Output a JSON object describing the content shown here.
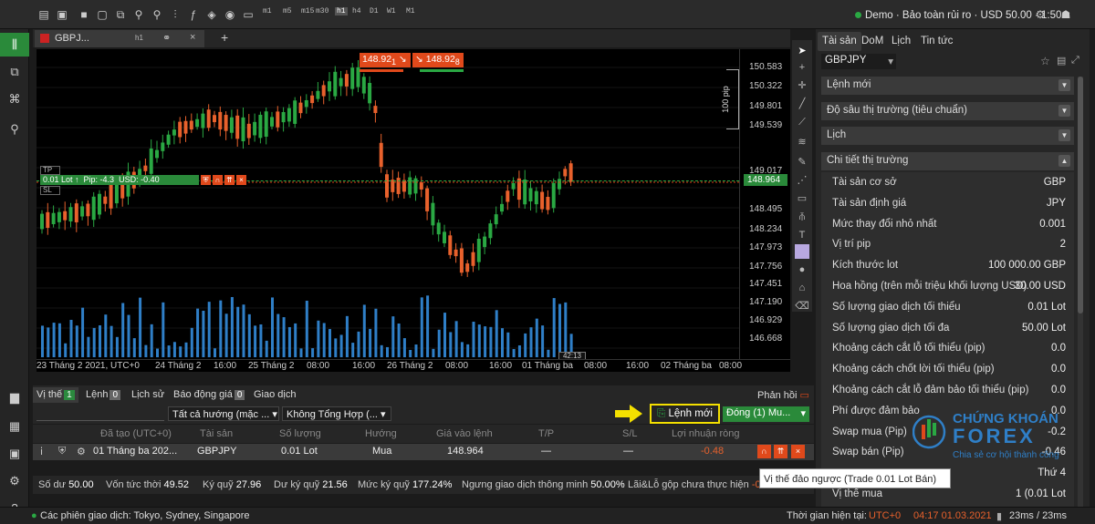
{
  "topbar": {
    "timeframes": [
      "m1",
      "m5",
      "m15",
      "m30",
      "h1",
      "h4",
      "D1",
      "W1",
      "M1"
    ],
    "active_timeframe": "h1",
    "account_status": "Demo · Bảo toàn rủi ro · USD 50.00 · 1:50"
  },
  "chart": {
    "tab_label": "GBPJ...",
    "tab_timeframe": "h1",
    "sell_price": "148.92",
    "sell_price_sub": "1",
    "buy_price": "148.92",
    "buy_price_sub": "8",
    "position_line": {
      "lot": "0.01 Lot",
      "pip": "Pip: -4.3",
      "usd": "USD: -0.40",
      "tp_label": "TP",
      "sl_label": "SL"
    },
    "pip_scale_label": "100 pip",
    "current_price": "148.964",
    "price_labels": [
      "150.583",
      "150.322",
      "149.801",
      "149.539",
      "149.017",
      "148.495",
      "148.234",
      "147.973",
      "147.756",
      "147.451",
      "147.190",
      "146.929",
      "146.668"
    ],
    "time_labels": [
      "23 Tháng 2 2021, UTC+0",
      "24 Tháng 2",
      "16:00",
      "25 Tháng 2",
      "08:00",
      "16:00",
      "26 Tháng 2",
      "08:00",
      "16:00",
      "01 Tháng ba",
      "08:00",
      "16:00",
      "02 Tháng ba",
      "08:00"
    ],
    "countdown": "42:13"
  },
  "right_panel": {
    "tabs": [
      "Tài sản",
      "DoM",
      "Lịch",
      "Tin tức"
    ],
    "asset": "GBPJPY",
    "sections": [
      "Lệnh mới",
      "Độ sâu thị trường (tiêu chuẩn)",
      "Lịch",
      "Chi tiết thị trường"
    ],
    "details": [
      {
        "label": "Tài sản cơ sở",
        "value": "GBP"
      },
      {
        "label": "Tài sản định giá",
        "value": "JPY"
      },
      {
        "label": "Mức thay đổi nhỏ nhất",
        "value": "0.001"
      },
      {
        "label": "Vị trí pip",
        "value": "2"
      },
      {
        "label": "Kích thước lot",
        "value": "100 000.00 GBP"
      },
      {
        "label": "Hoa hồng (trên mỗi triệu khối lượng USD)",
        "value": "30.00 USD"
      },
      {
        "label": "Số lượng giao dịch tối thiểu",
        "value": "0.01 Lot"
      },
      {
        "label": "Số lượng giao dịch tối đa",
        "value": "50.00 Lot"
      },
      {
        "label": "Khoảng cách cắt lỗ tối thiểu (pip)",
        "value": "0.0"
      },
      {
        "label": "Khoảng cách chốt lời tối thiểu (pip)",
        "value": "0.0"
      },
      {
        "label": "Khoảng cách cắt lỗ đảm bảo tối thiểu (pip)",
        "value": "0.0"
      },
      {
        "label": "Phí được đảm bảo",
        "value": "0.0"
      },
      {
        "label": "Swap mua (Pip)",
        "value": "-0.2"
      },
      {
        "label": "Swap bán (Pip)",
        "value": "-0.46"
      },
      {
        "label": "",
        "value": "Thứ 4"
      },
      {
        "label": "Vị thế mua",
        "value": "1 (0.01 Lot"
      }
    ]
  },
  "bottom": {
    "tabs": [
      {
        "label": "Vị thế",
        "count": "1"
      },
      {
        "label": "Lệnh",
        "count": "0"
      },
      {
        "label": "Lịch sử",
        "count": ""
      },
      {
        "label": "Báo động giá",
        "count": "0"
      },
      {
        "label": "Giao dịch",
        "count": ""
      }
    ],
    "feedback": "Phản hồi",
    "filter_direction": "Tất cả hướng (mặc ...",
    "filter_total": "Không Tổng Hợp (...",
    "new_order": "Lệnh mới",
    "close_btn": "Đóng (1) Mu...",
    "columns": [
      "Đã tạo (UTC+0)",
      "Tài sản",
      "Số lượng",
      "Hướng",
      "Giá vào lệnh",
      "T/P",
      "S/L",
      "Lợi nhuận ròng"
    ],
    "position": {
      "created": "01 Tháng ba 202...",
      "asset": "GBPJPY",
      "qty": "0.01 Lot",
      "direction": "Mua",
      "entry": "148.964",
      "tp": "—",
      "sl": "—",
      "pnl": "-0.48"
    },
    "status": [
      {
        "label": "Số dư",
        "value": "50.00"
      },
      {
        "label": "Vốn tức thời",
        "value": "49.52"
      },
      {
        "label": "Ký quỹ",
        "value": "27.96"
      },
      {
        "label": "Dư ký quỹ",
        "value": "21.56"
      },
      {
        "label": "Mức ký quỹ",
        "value": "177.24%"
      },
      {
        "label": "Ngưng giao dịch thông minh",
        "value": "50.00%"
      },
      {
        "label": "Lãi&Lỗ gộp chưa thực hiện",
        "value": "-0."
      }
    ],
    "tooltip": "Vị thế đảo ngược (Trade 0.01 Lot Bán)"
  },
  "footer": {
    "sessions": "Các phiên giao dịch: Tokyo, Sydney, Singapore",
    "server_time_label": "Thời gian hiện tại:",
    "timezone": "UTC+0",
    "time": "04:17 01.03.2021",
    "latency": "23ms / 23ms"
  },
  "watermark": {
    "brand": "CHỨNG KHOÁN FOREX",
    "tagline": "Chia sẻ cơ hội thành công"
  },
  "colors": {
    "bull": "#2aa843",
    "bear": "#e8612c",
    "volume": "#2f7fc7",
    "accent": "#f4e000"
  }
}
